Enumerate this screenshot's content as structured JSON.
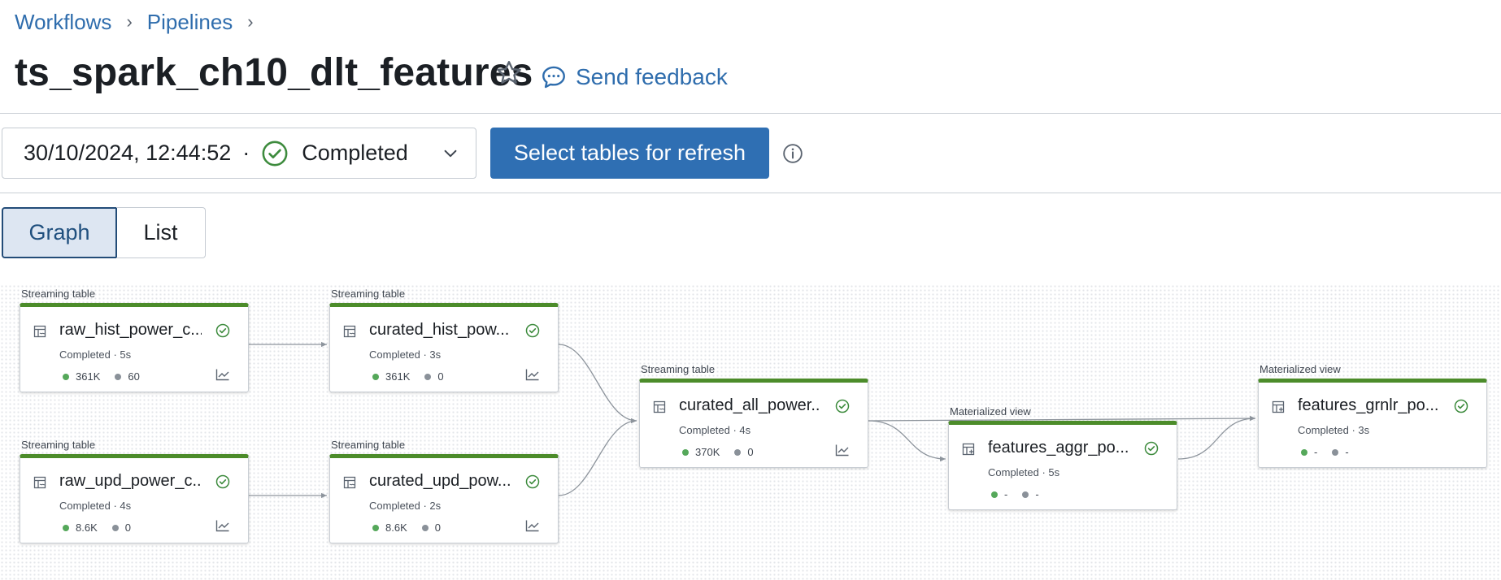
{
  "breadcrumb": {
    "items": [
      {
        "label": "Workflows"
      },
      {
        "label": "Pipelines"
      }
    ],
    "separator": "›"
  },
  "title": "ts_spark_ch10_dlt_features",
  "feedback": {
    "label": "Send feedback"
  },
  "run": {
    "timestamp": "30/10/2024, 12:44:52",
    "separator": "·",
    "status": "Completed"
  },
  "refresh_button": {
    "label": "Select tables for refresh"
  },
  "view_toggle": {
    "graph": "Graph",
    "list": "List",
    "selected": "Graph"
  },
  "colors": {
    "accent": "#2f6fb3",
    "success": "#4c8c2a",
    "link": "#2f6dad",
    "metric_green": "#55a85a",
    "metric_gray": "#8a9199"
  },
  "nodes": [
    {
      "type": "Streaming table",
      "name": "raw_hist_power_c...",
      "status": "Completed · 5s",
      "m1": "361K",
      "m2": "60",
      "icon": "streaming-table-icon"
    },
    {
      "type": "Streaming table",
      "name": "curated_hist_pow...",
      "status": "Completed · 3s",
      "m1": "361K",
      "m2": "0",
      "icon": "streaming-table-icon"
    },
    {
      "type": "Streaming table",
      "name": "raw_upd_power_c...",
      "status": "Completed · 4s",
      "m1": "8.6K",
      "m2": "0",
      "icon": "streaming-table-icon"
    },
    {
      "type": "Streaming table",
      "name": "curated_upd_pow...",
      "status": "Completed · 2s",
      "m1": "8.6K",
      "m2": "0",
      "icon": "streaming-table-icon"
    },
    {
      "type": "Streaming table",
      "name": "curated_all_power...",
      "status": "Completed · 4s",
      "m1": "370K",
      "m2": "0",
      "icon": "streaming-table-icon"
    },
    {
      "type": "Materialized view",
      "name": "features_aggr_po...",
      "status": "Completed · 5s",
      "m1": "-",
      "m2": "-",
      "icon": "materialized-view-icon"
    },
    {
      "type": "Materialized view",
      "name": "features_grnlr_po...",
      "status": "Completed · 3s",
      "m1": "-",
      "m2": "-",
      "icon": "materialized-view-icon"
    }
  ]
}
